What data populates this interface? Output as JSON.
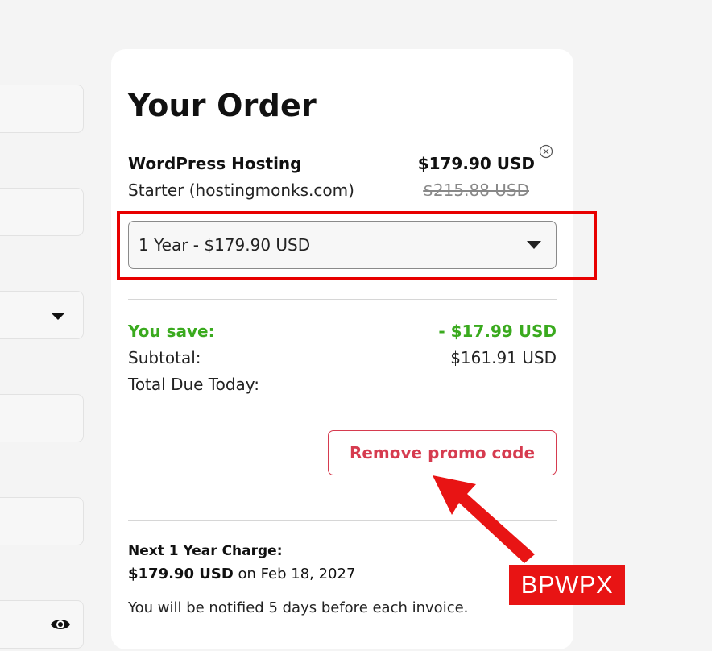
{
  "order": {
    "title": "Your Order",
    "product_name": "WordPress Hosting",
    "product_sub": "Starter (hostingmonks.com)",
    "price": "$179.90 USD",
    "old_price": "$215.88 USD",
    "billing_cycle_selected": "1 Year - $179.90 USD"
  },
  "summary": {
    "save_label": "You save:",
    "save_value": "- $17.99 USD",
    "subtotal_label": "Subtotal:",
    "subtotal_value": "$161.91 USD",
    "total_label": "Total Due Today:",
    "total_value": ""
  },
  "promo": {
    "remove_label": "Remove promo code"
  },
  "next_charge": {
    "label": "Next 1 Year Charge:",
    "amount": "$179.90 USD",
    "date_text": " on Feb 18, 2027",
    "notify_text": "You will be notified 5 days before each invoice."
  },
  "annotation": {
    "stamp_text": "BPWPX",
    "color": "#e81414"
  },
  "colors": {
    "accent_green": "#3aaa1e",
    "accent_red": "#d63b4f"
  },
  "icons": [
    "remove-icon",
    "caret-down-icon",
    "eye-icon"
  ]
}
